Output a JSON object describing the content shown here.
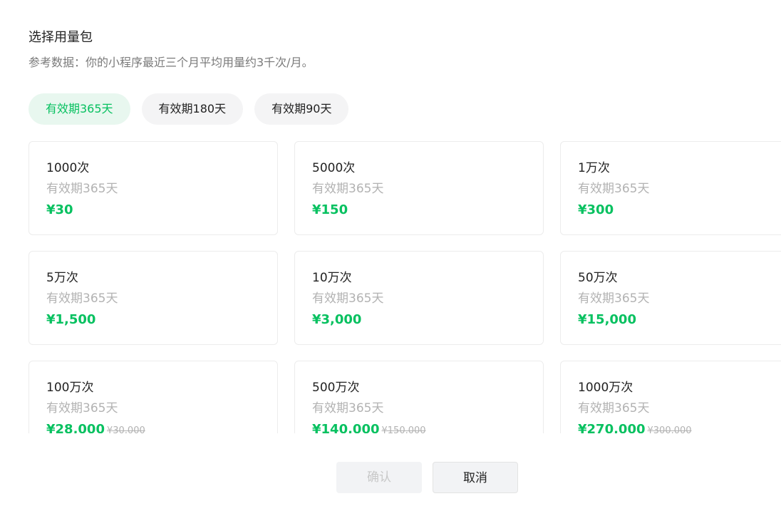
{
  "dialog": {
    "title": "选择用量包",
    "subtitle": "参考数据：你的小程序最近三个月平均用量约3千次/月。"
  },
  "tabs": [
    {
      "label": "有效期365天",
      "active": true
    },
    {
      "label": "有效期180天",
      "active": false
    },
    {
      "label": "有效期90天",
      "active": false
    }
  ],
  "packages": [
    {
      "amount": "1000次",
      "validity": "有效期365天",
      "price": "¥30",
      "original_price": ""
    },
    {
      "amount": "5000次",
      "validity": "有效期365天",
      "price": "¥150",
      "original_price": ""
    },
    {
      "amount": "1万次",
      "validity": "有效期365天",
      "price": "¥300",
      "original_price": ""
    },
    {
      "amount": "5万次",
      "validity": "有效期365天",
      "price": "¥1,500",
      "original_price": ""
    },
    {
      "amount": "10万次",
      "validity": "有效期365天",
      "price": "¥3,000",
      "original_price": ""
    },
    {
      "amount": "50万次",
      "validity": "有效期365天",
      "price": "¥15,000",
      "original_price": ""
    },
    {
      "amount": "100万次",
      "validity": "有效期365天",
      "price": "¥28,000",
      "original_price": "¥30,000"
    },
    {
      "amount": "500万次",
      "validity": "有效期365天",
      "price": "¥140,000",
      "original_price": "¥150,000"
    },
    {
      "amount": "1000万次",
      "validity": "有效期365天",
      "price": "¥270,000",
      "original_price": "¥300,000"
    }
  ],
  "footer": {
    "confirm_label": "确认",
    "cancel_label": "取消"
  },
  "colors": {
    "accent": "#07c160",
    "accent_bg": "#e8f7ef"
  }
}
